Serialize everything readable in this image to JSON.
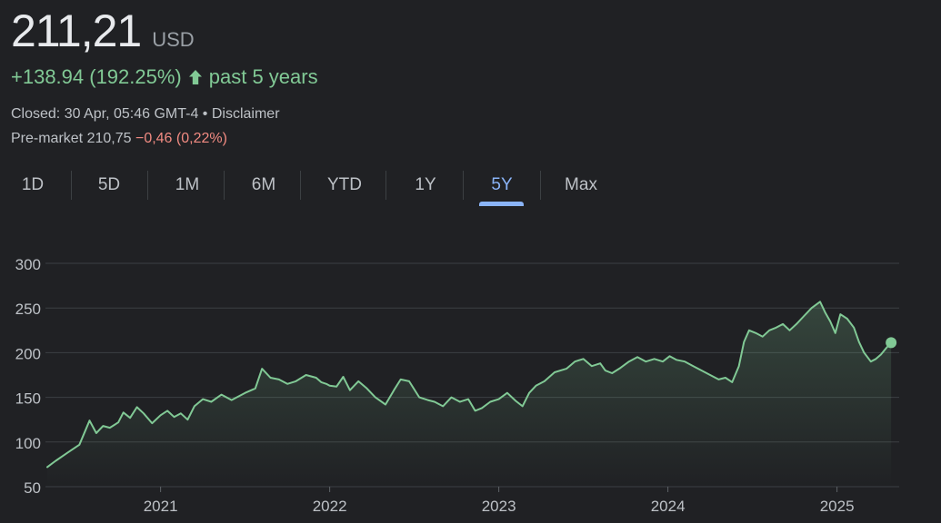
{
  "quote": {
    "price": "211,21",
    "currency": "USD",
    "change": "+138.94 (192.25%)",
    "change_period": "past 5 years",
    "closed_text": "Closed: 30 Apr, 05:46 GMT-4",
    "separator": "•",
    "disclaimer": "Disclaimer",
    "premarket_label": "Pre-market 210,75",
    "premarket_change": "−0,46 (0,22%)",
    "positive_color": "#81c995",
    "negative_color": "#f28b82"
  },
  "tabs": [
    {
      "label": "1D",
      "active": false
    },
    {
      "label": "5D",
      "active": false
    },
    {
      "label": "1M",
      "active": false
    },
    {
      "label": "6M",
      "active": false
    },
    {
      "label": "YTD",
      "active": false
    },
    {
      "label": "1Y",
      "active": false
    },
    {
      "label": "5Y",
      "active": true
    },
    {
      "label": "Max",
      "active": false
    }
  ],
  "chart_data": {
    "type": "area",
    "title": "",
    "xlabel": "",
    "ylabel": "",
    "ylim": [
      50,
      300
    ],
    "y_ticks": [
      50,
      100,
      150,
      200,
      250,
      300
    ],
    "xlim": [
      2020.33,
      2025.33
    ],
    "x_ticks": [
      2021,
      2022,
      2023,
      2024,
      2025
    ],
    "x_tick_labels": [
      "2021",
      "2022",
      "2023",
      "2024",
      "2025"
    ],
    "grid": true,
    "line_color": "#81c995",
    "series": [
      {
        "x": [
          2020.33,
          2020.38,
          2020.45,
          2020.52,
          2020.58,
          2020.62,
          2020.66,
          2020.7,
          2020.75,
          2020.78,
          2020.82,
          2020.86,
          2020.9,
          2020.95,
          2021.0,
          2021.04,
          2021.08,
          2021.12,
          2021.16,
          2021.2,
          2021.25,
          2021.3,
          2021.36,
          2021.42,
          2021.5,
          2021.56,
          2021.6,
          2021.65,
          2021.7,
          2021.75,
          2021.8,
          2021.86,
          2021.92,
          2021.95,
          2021.98,
          2022.0,
          2022.04,
          2022.08,
          2022.12,
          2022.17,
          2022.22,
          2022.27,
          2022.33,
          2022.38,
          2022.42,
          2022.47,
          2022.53,
          2022.58,
          2022.62,
          2022.67,
          2022.72,
          2022.77,
          2022.82,
          2022.86,
          2022.9,
          2022.95,
          2023.0,
          2023.05,
          2023.1,
          2023.14,
          2023.18,
          2023.22,
          2023.27,
          2023.33,
          2023.4,
          2023.45,
          2023.5,
          2023.55,
          2023.6,
          2023.63,
          2023.67,
          2023.72,
          2023.77,
          2023.82,
          2023.87,
          2023.92,
          2023.97,
          2024.01,
          2024.05,
          2024.1,
          2024.15,
          2024.2,
          2024.25,
          2024.3,
          2024.34,
          2024.38,
          2024.42,
          2024.45,
          2024.48,
          2024.52,
          2024.56,
          2024.6,
          2024.64,
          2024.68,
          2024.72,
          2024.76,
          2024.8,
          2024.85,
          2024.9,
          2024.93,
          2024.96,
          2024.99,
          2025.02,
          2025.06,
          2025.1,
          2025.13,
          2025.16,
          2025.2,
          2025.23,
          2025.26,
          2025.29,
          2025.32
        ],
        "y": [
          72,
          79,
          88,
          97,
          124,
          110,
          118,
          116,
          122,
          133,
          127,
          139,
          132,
          121,
          130,
          135,
          128,
          132,
          125,
          140,
          148,
          145,
          153,
          147,
          155,
          160,
          182,
          172,
          170,
          165,
          168,
          175,
          172,
          167,
          165,
          163,
          162,
          173,
          158,
          168,
          160,
          150,
          142,
          158,
          170,
          168,
          150,
          147,
          145,
          140,
          150,
          145,
          148,
          135,
          138,
          145,
          148,
          155,
          146,
          140,
          155,
          163,
          168,
          178,
          182,
          190,
          193,
          185,
          188,
          180,
          177,
          183,
          190,
          195,
          190,
          193,
          190,
          196,
          192,
          190,
          185,
          180,
          175,
          170,
          172,
          167,
          185,
          212,
          225,
          222,
          218,
          225,
          228,
          232,
          225,
          232,
          240,
          250,
          257,
          245,
          235,
          222,
          243,
          238,
          228,
          212,
          200,
          190,
          193,
          198,
          205,
          211.21
        ]
      }
    ]
  }
}
